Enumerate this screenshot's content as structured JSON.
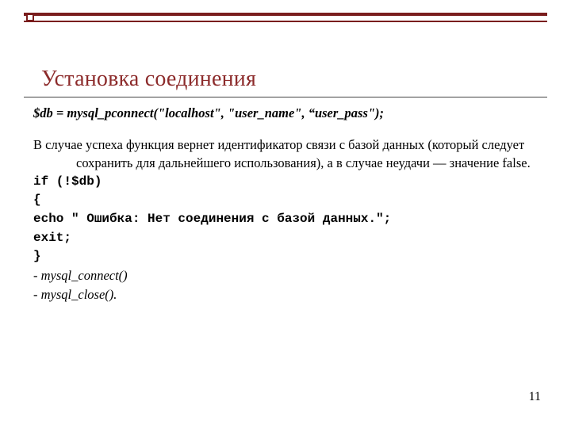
{
  "title": "Установка соединения",
  "body": {
    "pconnect": "$db = mysql_pconnect(\"localhost\", \"user_name\", “user_pass\");",
    "desc": "В случае успеха функция вернет идентификатор связи с базой данных (который следует сохранить для дальнейшего использования), а в случае неудачи — значение false.",
    "code": {
      "l1": "if (!$db)",
      "l2": "{",
      "l3": "echo \" Ошибка: Нет соединения с базой данных.\";",
      "l4": "exit;",
      "l5": "}"
    },
    "bullets": [
      " - mysql_connect()",
      " - mysql_close()."
    ]
  },
  "page": "11"
}
